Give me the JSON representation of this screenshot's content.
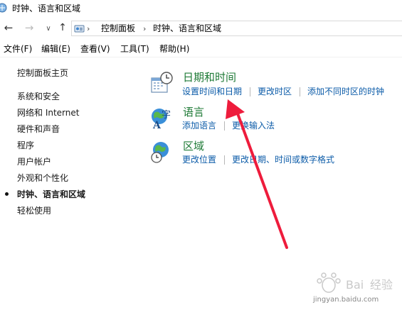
{
  "window": {
    "title": "时钟、语言和区域"
  },
  "address": {
    "crumbs": [
      "控制面板",
      "时钟、语言和区域"
    ]
  },
  "menu": {
    "items": [
      "文件(F)",
      "编辑(E)",
      "查看(V)",
      "工具(T)",
      "帮助(H)"
    ]
  },
  "sidebar": {
    "home": "控制面板主页",
    "items": [
      "系统和安全",
      "网络和 Internet",
      "硬件和声音",
      "程序",
      "用户帐户",
      "外观和个性化",
      "时钟、语言和区域",
      "轻松使用"
    ],
    "current_index": 6
  },
  "categories": [
    {
      "title": "日期和时间",
      "links": [
        "设置时间和日期",
        "更改时区",
        "添加不同时区的时钟"
      ]
    },
    {
      "title": "语言",
      "links": [
        "添加语言",
        "更换输入法"
      ]
    },
    {
      "title": "区域",
      "links": [
        "更改位置",
        "更改日期、时间或数字格式"
      ]
    }
  ],
  "watermark": {
    "text": "jingyan.baidu.com"
  },
  "colors": {
    "category_title": "#1e7a36",
    "link": "#0b5ba8",
    "annotation_arrow": "#ee1c3c"
  }
}
